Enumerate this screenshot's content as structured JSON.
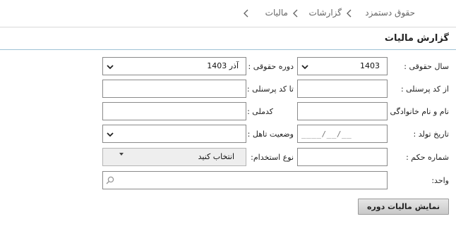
{
  "breadcrumb": {
    "items": [
      "حقوق دستمزد",
      "گزارشات",
      "مالیات"
    ],
    "separator_icon": "chevron-left-icon"
  },
  "page": {
    "title": "گزارش مالیات"
  },
  "form": {
    "payroll_year": {
      "label": "سال حقوقی :",
      "value": "1403"
    },
    "payroll_period": {
      "label": "دوره حقوقی :",
      "value": "آذر 1403"
    },
    "from_personnel_code": {
      "label": "از کد پرسنلی :",
      "value": ""
    },
    "to_personnel_code": {
      "label": "تا کد پرسنلی :",
      "value": ""
    },
    "full_name": {
      "label": "نام و نام خانوادگی :",
      "value": ""
    },
    "national_code": {
      "label": "کدملی :",
      "value": ""
    },
    "birth_date": {
      "label": "تاریخ تولد :",
      "placeholder": "____/__/__"
    },
    "marital_status": {
      "label": "وضعیت تاهل :",
      "value": ""
    },
    "decree_number": {
      "label": "شماره حکم :",
      "value": ""
    },
    "employment_type": {
      "label": "نوع استخدام:",
      "value": "انتخاب کنید"
    },
    "unit": {
      "label": "واحد:",
      "value": ""
    }
  },
  "actions": {
    "show_period_tax_label": "نمایش مالیات دوره"
  },
  "colors": {
    "title_underline": "#9fc2d6",
    "field_border": "#8a8a8a",
    "button_bg": "#d4d4d4"
  }
}
